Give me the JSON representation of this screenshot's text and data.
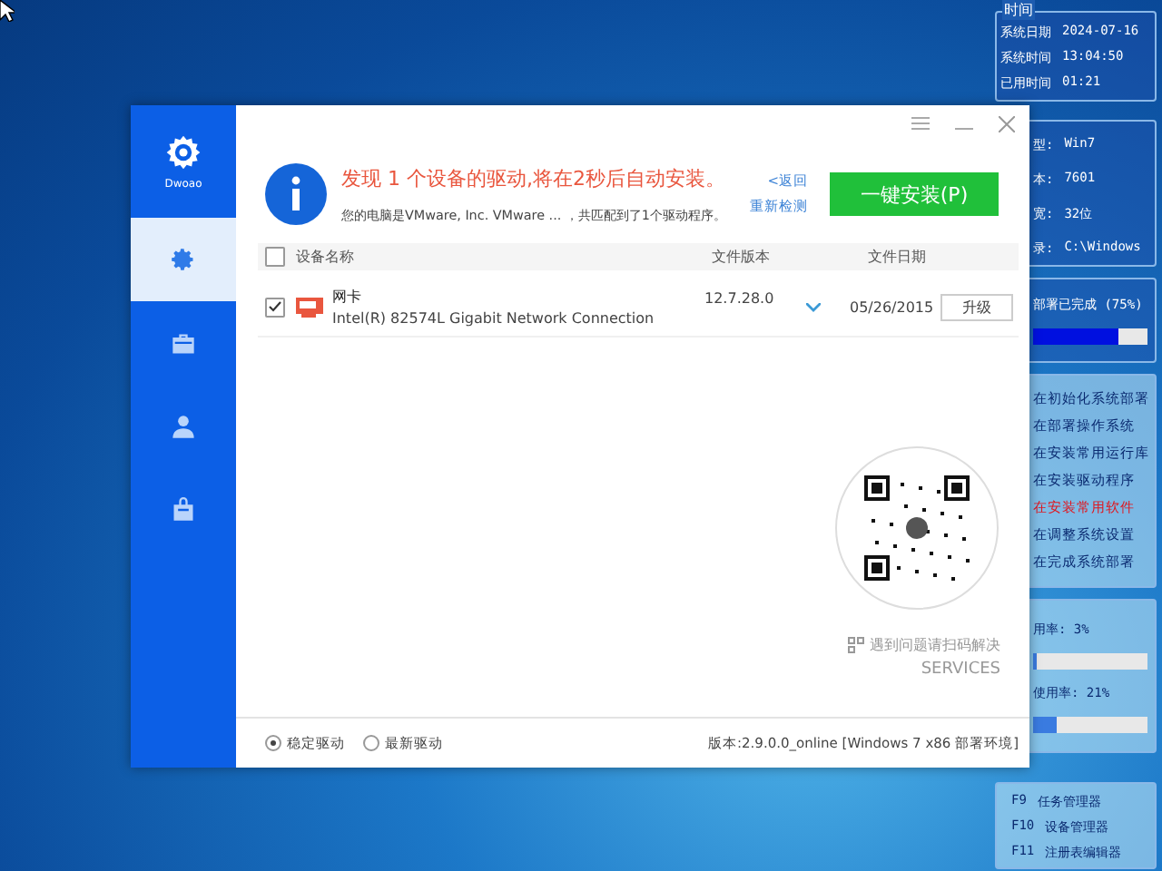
{
  "side_panel": {
    "time": {
      "title": "时间",
      "rows": [
        {
          "label": "系统日期",
          "value": "2024-07-16"
        },
        {
          "label": "系统时间",
          "value": "13:04:50"
        },
        {
          "label": "已用时间",
          "value": "01:21"
        }
      ]
    },
    "system": [
      {
        "label": "型:",
        "value": "Win7"
      },
      {
        "label": "本:",
        "value": "7601"
      },
      {
        "label": "宽:",
        "value": "32位"
      },
      {
        "label": "录:",
        "value": "C:\\Windows"
      }
    ],
    "progress": {
      "label": "部署已完成 (75%)",
      "level": 0.75
    },
    "steps": [
      {
        "label": "在初始化系统部署",
        "current": false
      },
      {
        "label": "在部署操作系统",
        "current": false
      },
      {
        "label": "在安装常用运行库",
        "current": false
      },
      {
        "label": "在安装驱动程序",
        "current": false
      },
      {
        "label": "在安装常用软件",
        "current": true
      },
      {
        "label": "在调整系统设置",
        "current": false
      },
      {
        "label": "在完成系统部署",
        "current": false
      }
    ],
    "usage": [
      {
        "label": "用率:  3%",
        "level": 0.03
      },
      {
        "label": "使用率: 21%",
        "level": 0.21
      }
    ],
    "hotkeys": [
      {
        "key": "F9",
        "label": "任务管理器"
      },
      {
        "key": "F10",
        "label": "设备管理器"
      },
      {
        "key": "F11",
        "label": "注册表编辑器"
      }
    ]
  },
  "dialog": {
    "logo": "Dwoao",
    "nav": [
      {
        "selected": true
      },
      {
        "selected": false
      },
      {
        "selected": false
      },
      {
        "selected": false
      }
    ],
    "title": "发现 1 个设备的驱动,将在2秒后自动安装。",
    "subtitle": "您的电脑是VMware, Inc. VMware ... ，共匹配到了1个驱动程序。",
    "back_link": "<返回",
    "recheck_link": "重新检测",
    "install_button": "一键安装(P)",
    "table": {
      "columns": [
        "设备名称",
        "文件版本",
        "文件日期"
      ],
      "all_checked": false,
      "rows": [
        {
          "checked": true,
          "name": "网卡",
          "description": "Intel(R) 82574L Gigabit Network Connection",
          "version": "12.7.28.0",
          "date": "05/26/2015",
          "action": "升级"
        }
      ]
    },
    "qr": {
      "caption": "遇到问题请扫码解决",
      "subcaption": "SERVICES"
    },
    "driver_options": [
      {
        "label": "稳定驱动",
        "selected": true
      },
      {
        "label": "最新驱动",
        "selected": false
      }
    ],
    "version": "版本:2.9.0.0_online [Windows 7 x86 部署环境]"
  }
}
